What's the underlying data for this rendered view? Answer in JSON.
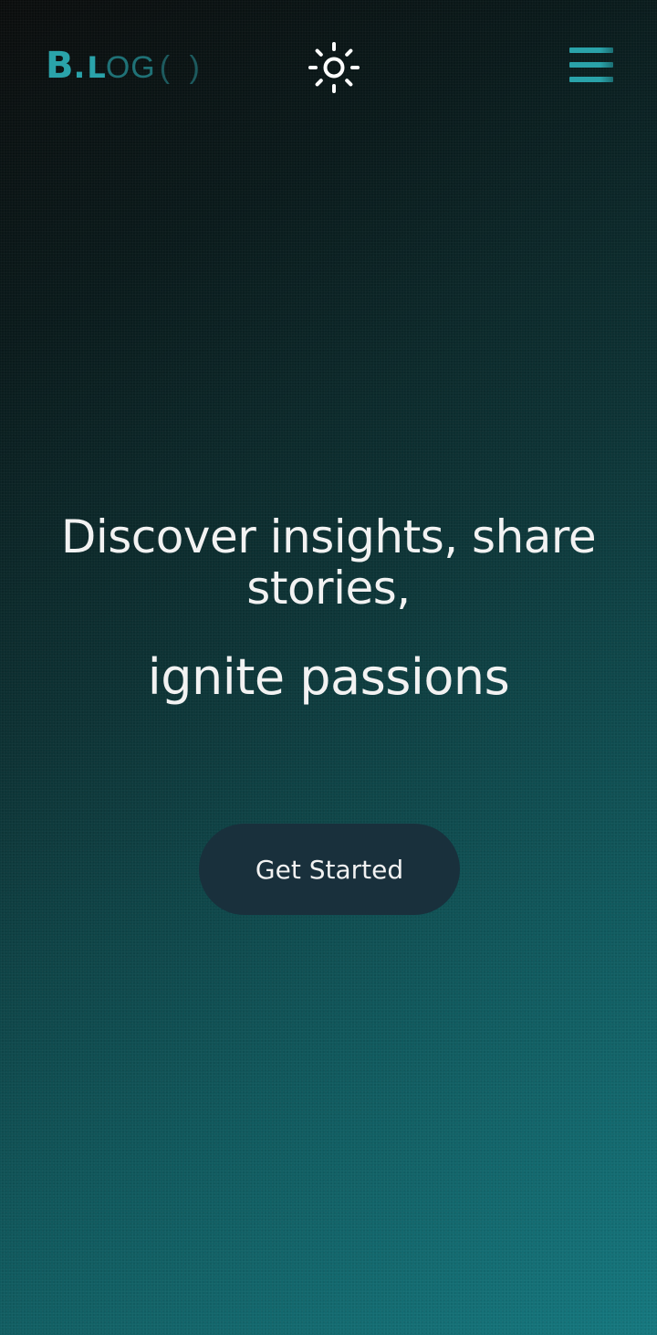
{
  "navbar": {
    "logo": {
      "b": "B",
      "dot": ".",
      "l": "L",
      "og": "OG",
      "parens": "( )"
    },
    "theme_toggle_icon": "sun-icon",
    "menu_icon": "hamburger-menu-icon"
  },
  "hero": {
    "line1": "Discover insights, share stories,",
    "line2": "ignite passions",
    "cta_label": "Get Started"
  },
  "colors": {
    "accent": "#2aa3aa",
    "background_start": "#0b0d0d",
    "background_end": "#15787f",
    "cta_background": "#19303c",
    "text": "#f2f2f2"
  }
}
